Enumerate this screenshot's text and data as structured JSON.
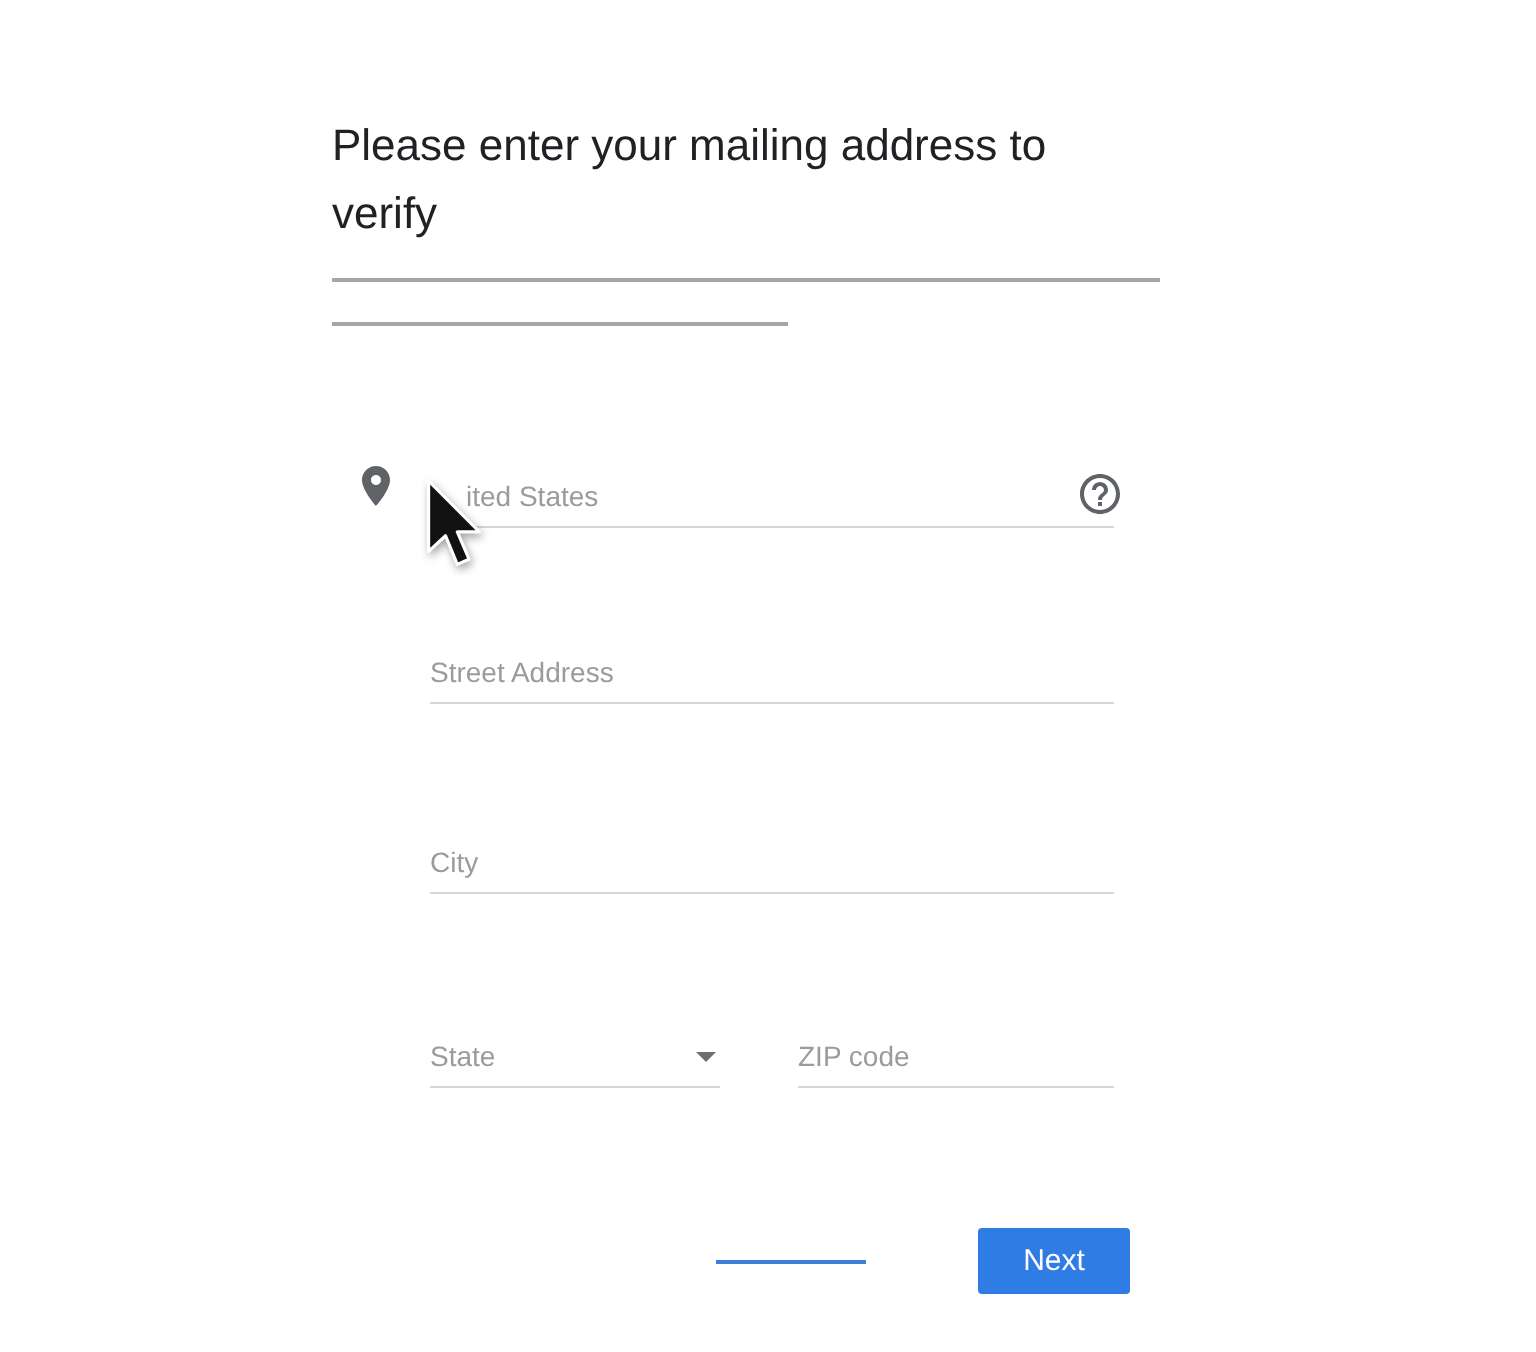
{
  "heading": "Please enter your mailing address to verify",
  "fields": [
    {
      "kind": "country",
      "value": "ited States"
    },
    {
      "kind": "text",
      "placeholder": "Street Address"
    },
    {
      "kind": "text",
      "placeholder": "City"
    }
  ],
  "split_fields": [
    {
      "kind": "dropdown",
      "placeholder": "State"
    },
    {
      "kind": "text",
      "placeholder": "ZIP code"
    }
  ],
  "actions": [
    {
      "kind": "link"
    },
    {
      "kind": "primary",
      "label": "Next"
    }
  ]
}
